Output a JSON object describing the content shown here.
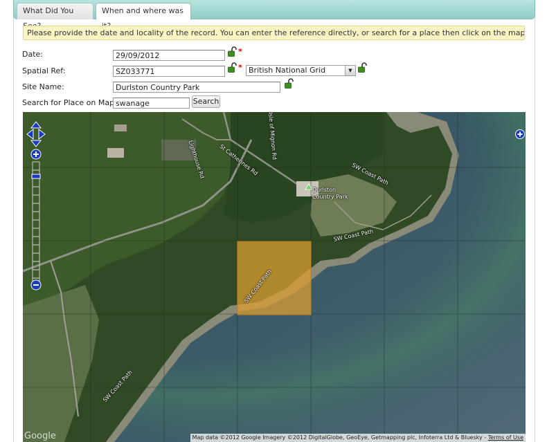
{
  "tabs": [
    {
      "label": "What Did You See?",
      "active": false
    },
    {
      "label": "When and where was it?",
      "active": true
    }
  ],
  "notice": "Please provide the date and locality of the record. You can enter the reference directly, or search for a place then click on the map to set it.",
  "form": {
    "date": {
      "label": "Date:",
      "value": "29/09/2012",
      "required": "*"
    },
    "spatial_ref": {
      "label": "Spatial Ref:",
      "value": "SZ033771",
      "required": "*",
      "system": "British National Grid"
    },
    "site_name": {
      "label": "Site Name:",
      "value": "Durlston Country Park"
    },
    "search": {
      "label": "Search for Place on Map:",
      "value": "swanage",
      "button": "Search"
    }
  },
  "map": {
    "labels": {
      "road_lighthouse": "Lighthouse Rd",
      "road_catherines": "St Catherines Rd",
      "road_mignon": "Isle of Mignon Rd",
      "place_name_1": "Durlston",
      "place_name_2": "Country Park",
      "path_1": "SW Coast Path",
      "path_2": "SW Coast Path",
      "path_3": "SW Coast Path",
      "path_4": "SW Coast Path"
    },
    "logo": "Google",
    "attribution": "Map data ©2012 Google Imagery ©2012 DigitalGlobe, GeoEye, Getmapping plc, Infoterra Ltd & Bluesky - ",
    "terms": "Terms of Use",
    "highlight_color": "#e0a030"
  }
}
